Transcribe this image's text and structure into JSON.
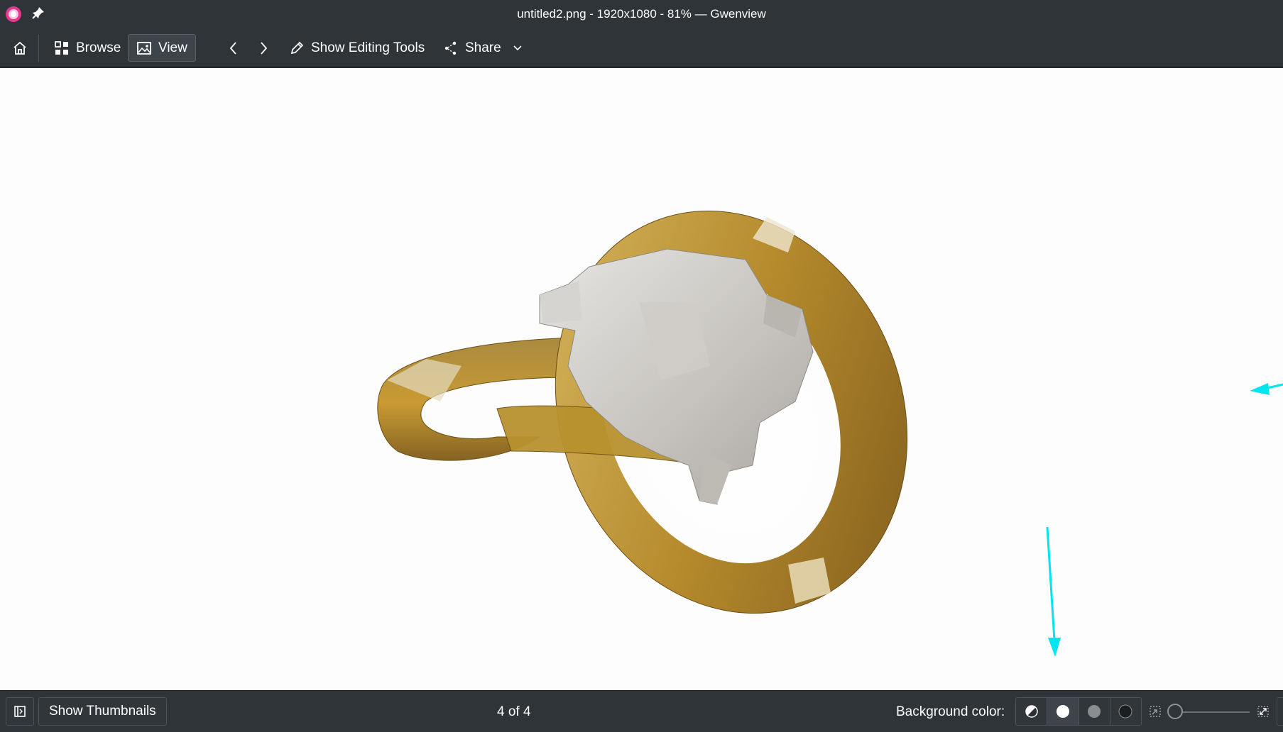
{
  "window": {
    "title": "untitled2.png - 1920x1080 - 81% — Gwenview",
    "app_icon": "gwenview-app-icon",
    "pin_icon": "pin-icon"
  },
  "toolbar": {
    "home_icon": "home-icon",
    "browse_label": "Browse",
    "view_label": "View",
    "prev_icon": "chevron-left-icon",
    "next_icon": "chevron-right-icon",
    "editing_label": "Show Editing Tools",
    "share_label": "Share"
  },
  "viewer": {
    "image_description_icon": "3d-render-image",
    "annotation_arrow_color": "#00e5f0"
  },
  "statusbar": {
    "thumbnails_label": "Show Thumbnails",
    "position_text": "4 of 4",
    "background_label": "Background color:",
    "background_options": [
      "auto",
      "white",
      "grey",
      "black"
    ],
    "selected_background": "white",
    "zoom_level": 0
  },
  "colors": {
    "chrome": "#2f3438",
    "canvas": "#fdfdfd",
    "gold": "#c9a13d",
    "silver": "#c8c6c2"
  }
}
